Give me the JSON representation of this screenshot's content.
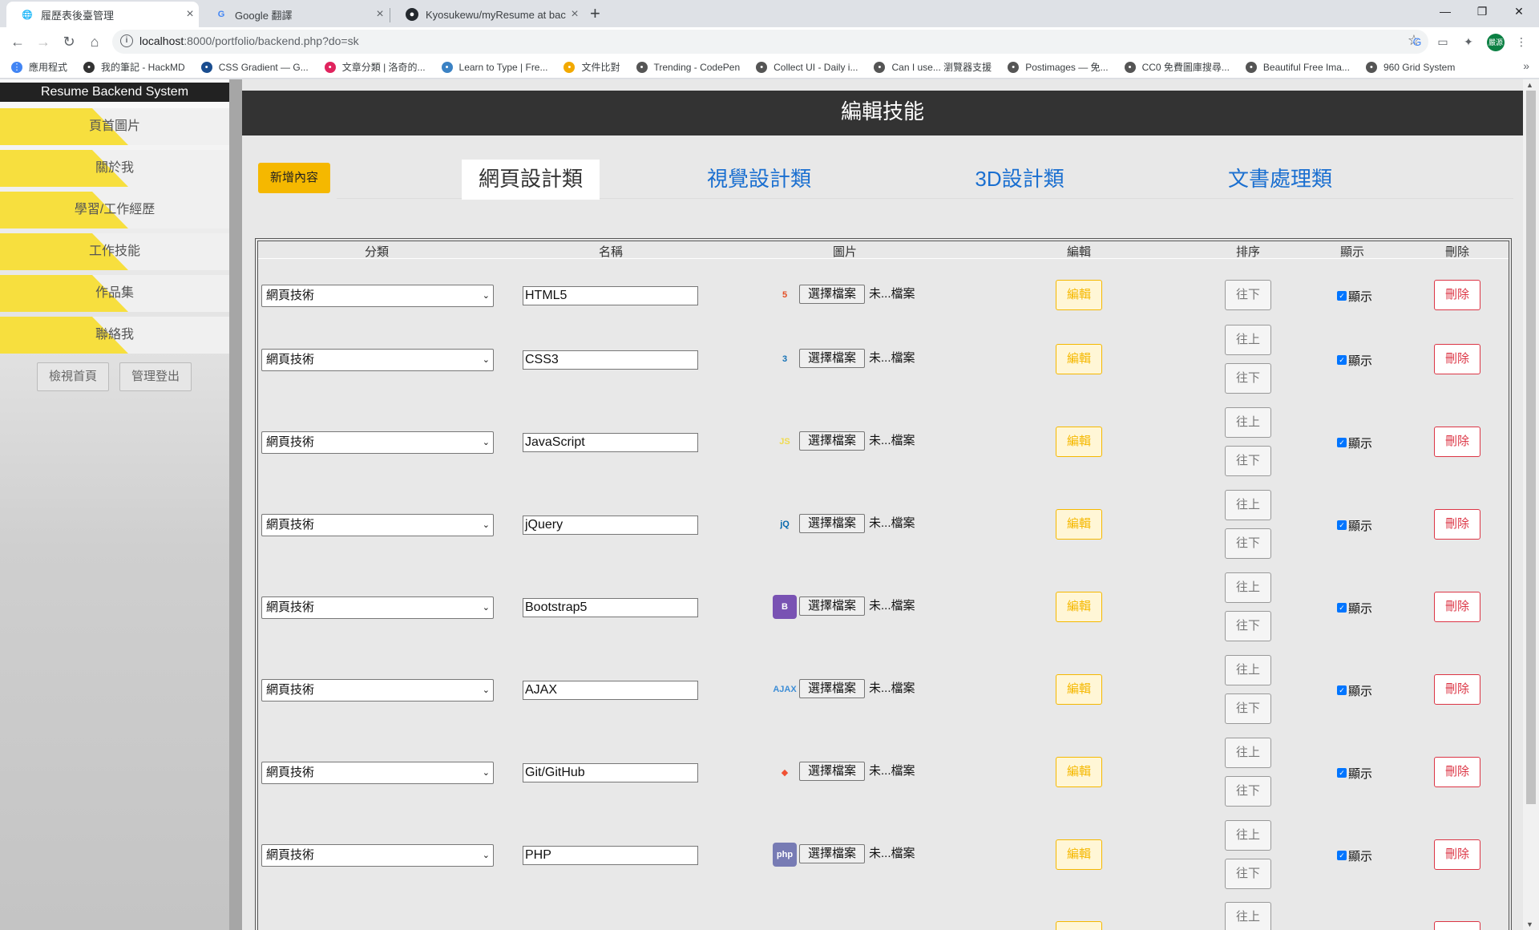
{
  "browser": {
    "tabs": [
      {
        "title": "履歷表後臺管理",
        "icon": "globe-icon"
      },
      {
        "title": "Google 翻譯",
        "icon": "google-translate-icon"
      },
      {
        "title": "Kyosukewu/myResume at back",
        "icon": "github-icon"
      }
    ],
    "new_tab": "+",
    "url_host": "localhost",
    "url_rest": ":8000/portfolio/backend.php?do=sk",
    "profile_initials": "嚴源",
    "bookmarks": [
      {
        "label": "應用程式",
        "icon": "apps-grid-icon",
        "color": "#4285f4"
      },
      {
        "label": "我的筆記 - HackMD",
        "icon": "hackmd-icon",
        "color": "#333333"
      },
      {
        "label": "CSS Gradient — G...",
        "icon": "css-gradient-icon",
        "color": "#1a4d8f"
      },
      {
        "label": "文章分類 | 洛奇的...",
        "icon": "kaoseng-icon",
        "color": "#e0245e"
      },
      {
        "label": "Learn to Type | Fre...",
        "icon": "typing-icon",
        "color": "#3b82c4"
      },
      {
        "label": "文件比對",
        "icon": "diff-icon",
        "color": "#f2a900"
      },
      {
        "label": "Trending - CodePen",
        "icon": "globe-icon",
        "color": "#555555"
      },
      {
        "label": "Collect UI - Daily i...",
        "icon": "globe-icon",
        "color": "#555555"
      },
      {
        "label": "Can I use... 瀏覽器支援",
        "icon": "globe-icon",
        "color": "#555555"
      },
      {
        "label": "Postimages — 免...",
        "icon": "globe-icon",
        "color": "#555555"
      },
      {
        "label": "CC0 免費圖庫搜尋...",
        "icon": "globe-icon",
        "color": "#555555"
      },
      {
        "label": "Beautiful Free Ima...",
        "icon": "globe-icon",
        "color": "#555555"
      },
      {
        "label": "960 Grid System",
        "icon": "globe-icon",
        "color": "#555555"
      }
    ],
    "more": "»"
  },
  "sidebar": {
    "title": "Resume Backend System",
    "items": [
      {
        "label": "頁首圖片"
      },
      {
        "label": "關於我"
      },
      {
        "label": "學習/工作經歷"
      },
      {
        "label": "工作技能"
      },
      {
        "label": "作品集"
      },
      {
        "label": "聯絡我"
      }
    ],
    "view_home": "檢視首頁",
    "logout": "管理登出"
  },
  "main": {
    "header": "編輯技能",
    "add_button": "新增內容",
    "tabs": [
      {
        "label": "網頁設計類",
        "active": true
      },
      {
        "label": "視覺設計類",
        "active": false
      },
      {
        "label": "3D設計類",
        "active": false
      },
      {
        "label": "文書處理類",
        "active": false
      }
    ],
    "columns": [
      "分類",
      "名稱",
      "圖片",
      "編輯",
      "排序",
      "顯示",
      "刪除"
    ],
    "labels": {
      "choose_file": "選擇檔案",
      "no_file": "未...檔案",
      "edit": "編輯",
      "move_up": "往上",
      "move_down": "往下",
      "show": "顯示",
      "delete": "刪除"
    },
    "rows": [
      {
        "category": "網頁技術",
        "name": "HTML5",
        "icon": "html5-icon",
        "icon_text": "5",
        "icon_color": "#e34f26",
        "has_up": false,
        "has_down": true,
        "shown": true
      },
      {
        "category": "網頁技術",
        "name": "CSS3",
        "icon": "css3-icon",
        "icon_text": "3",
        "icon_color": "#1572b6",
        "has_up": true,
        "has_down": true,
        "shown": true
      },
      {
        "category": "網頁技術",
        "name": "JavaScript",
        "icon": "javascript-icon",
        "icon_text": "JS",
        "icon_color": "#f0db4f",
        "has_up": true,
        "has_down": true,
        "shown": true
      },
      {
        "category": "網頁技術",
        "name": "jQuery",
        "icon": "jquery-icon",
        "icon_text": "jQ",
        "icon_color": "#0769ad",
        "has_up": true,
        "has_down": true,
        "shown": true
      },
      {
        "category": "網頁技術",
        "name": "Bootstrap5",
        "icon": "bootstrap-icon",
        "icon_text": "B",
        "icon_color": "#7952b3",
        "has_up": true,
        "has_down": true,
        "shown": true
      },
      {
        "category": "網頁技術",
        "name": "AJAX",
        "icon": "ajax-icon",
        "icon_text": "AJAX",
        "icon_color": "#3c8dd6",
        "has_up": true,
        "has_down": true,
        "shown": true
      },
      {
        "category": "網頁技術",
        "name": "Git/GitHub",
        "icon": "git-icon",
        "icon_text": "◆",
        "icon_color": "#f05032",
        "has_up": true,
        "has_down": true,
        "shown": true
      },
      {
        "category": "網頁技術",
        "name": "PHP",
        "icon": "php-icon",
        "icon_text": "php",
        "icon_color": "#777bb4",
        "has_up": true,
        "has_down": true,
        "shown": true
      }
    ],
    "partial_row_up": "往上"
  }
}
